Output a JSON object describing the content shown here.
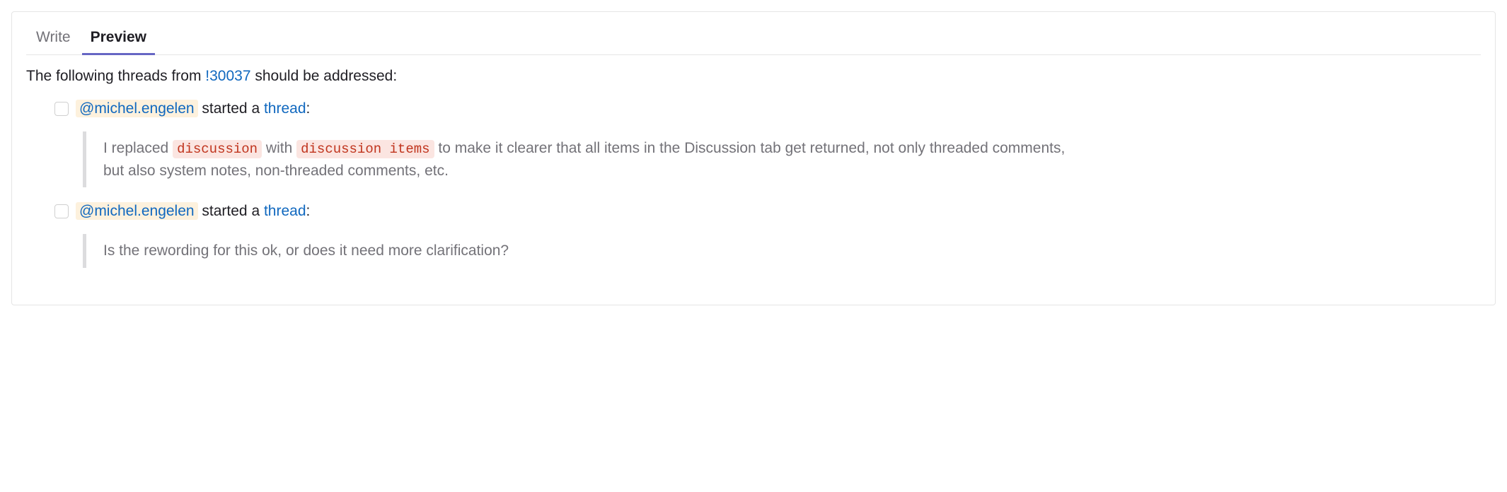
{
  "tabs": {
    "write": "Write",
    "preview": "Preview"
  },
  "intro": {
    "prefix": "The following threads from ",
    "mr_ref": "!30037",
    "suffix": " should be addressed:"
  },
  "threads": [
    {
      "mention": "@michel.engelen",
      "started_a": " started a ",
      "thread_word": "thread",
      "colon": ":",
      "quote_pre": "I replaced ",
      "code1": "discussion",
      "quote_mid": " with ",
      "code2": "discussion items",
      "quote_post": " to make it clearer that all items in the Discussion tab get returned, not only threaded comments, but also system notes, non-threaded comments, etc."
    },
    {
      "mention": "@michel.engelen",
      "started_a": " started a ",
      "thread_word": "thread",
      "colon": ":",
      "quote_full": "Is the rewording for this ok, or does it need more clarification?"
    }
  ]
}
